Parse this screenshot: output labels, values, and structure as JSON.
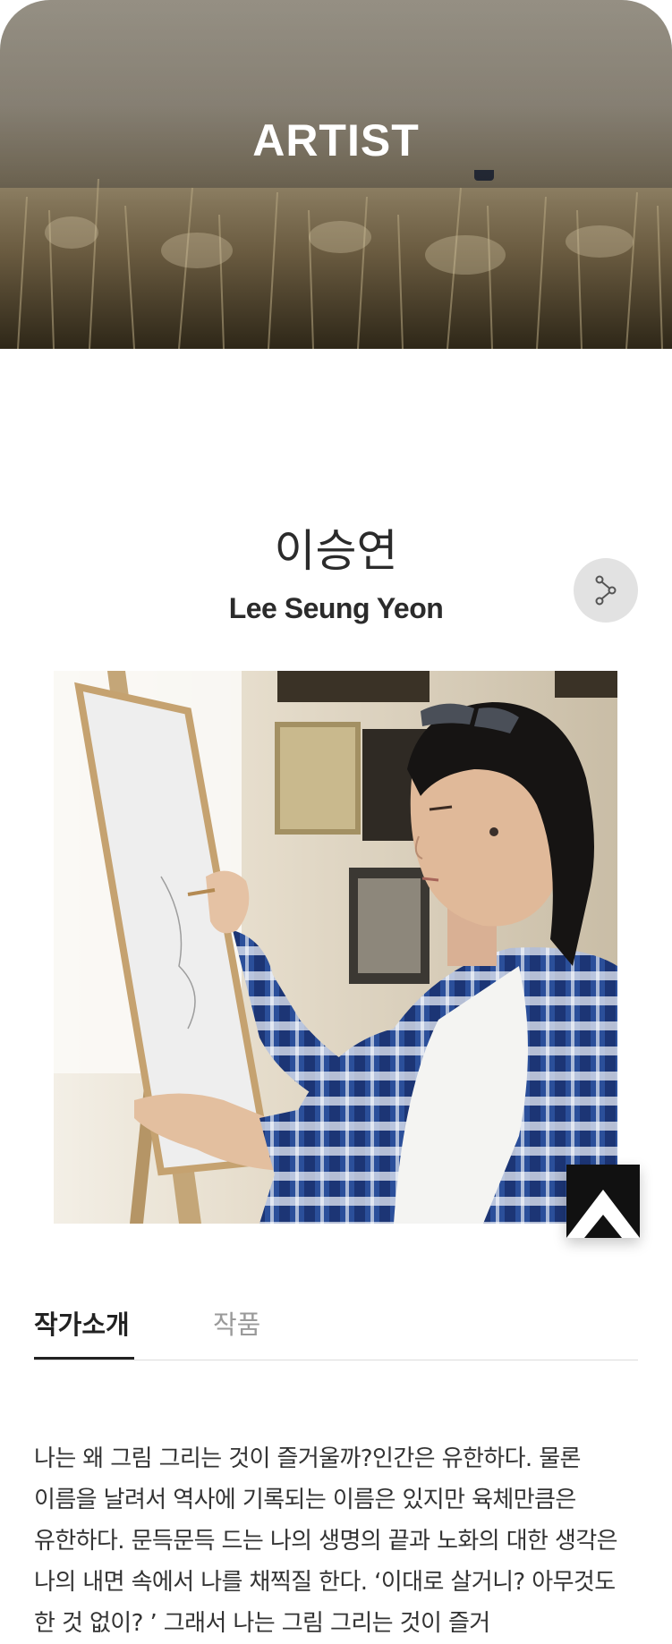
{
  "hero": {
    "title": "ARTIST"
  },
  "artist": {
    "name_ko": "이승연",
    "name_en": "Lee Seung Yeon"
  },
  "icons": {
    "share": "share-icon",
    "scroll_top": "scroll-top-icon"
  },
  "tabs": [
    {
      "label": "작가소개",
      "active": true
    },
    {
      "label": "작품",
      "active": false
    }
  ],
  "intro": {
    "text": "나는 왜 그림 그리는 것이 즐거울까?인간은 유한하다. 물론 이름을 날려서 역사에 기록되는 이름은 있지만 육체만큼은 유한하다. 문득문득 드는 나의 생명의 끝과 노화의 대한 생각은 나의 내면 속에서 나를 채찍질 한다. ‘이대로 살거니? 아무것도 한 것 없이? ’ 그래서 나는 그림 그리는 것이 즐거"
  },
  "colors": {
    "text": "#222222",
    "tab_inactive": "#9a9a9a",
    "share_bg": "#e2e2e2",
    "divider": "#dcdcdc"
  }
}
